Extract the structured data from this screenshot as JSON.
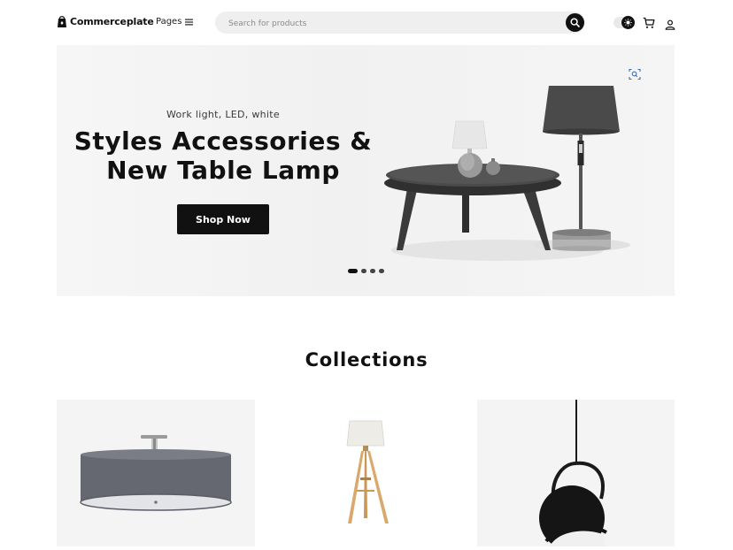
{
  "header": {
    "brand": "Commerceplate",
    "pages_label": "Pages",
    "search_placeholder": "Search for products"
  },
  "hero": {
    "kicker": "Work light, LED, white",
    "title": "Styles Accessories & New Table Lamp",
    "cta_label": "Shop Now",
    "slides_total": 4,
    "active_slide": 1
  },
  "collections": {
    "title": "Collections",
    "items": [
      {
        "icon": "ceiling-drum-lamp"
      },
      {
        "icon": "tripod-floor-lamp"
      },
      {
        "icon": "black-pendant-lamp"
      }
    ]
  },
  "colors": {
    "accent": "#111111",
    "hero_bg": "#f3f3f3",
    "search_bg": "#efefef"
  }
}
